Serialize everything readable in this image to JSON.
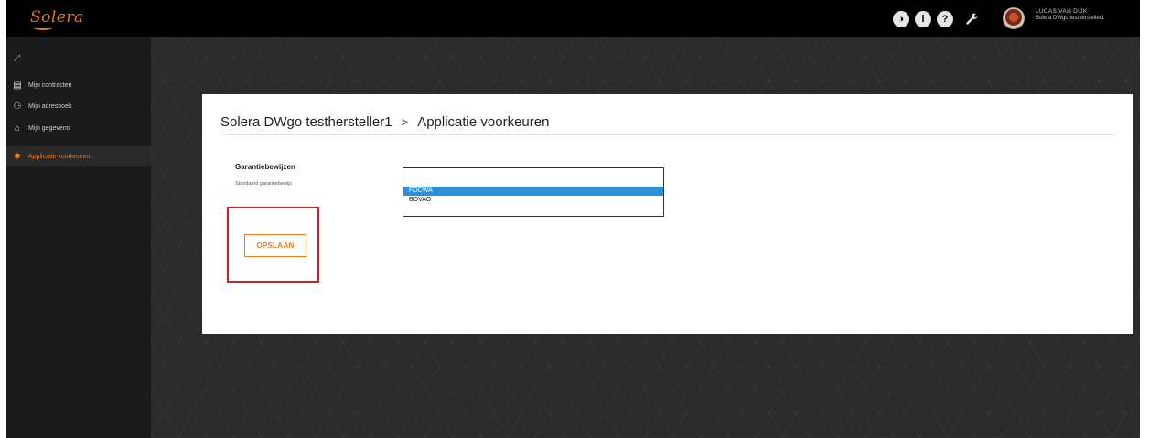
{
  "header": {
    "logo_text": "Solera",
    "icons": [
      "half-circle-icon",
      "info-icon",
      "help-icon",
      "wrench-icon"
    ],
    "icon_glyphs": [
      "◑",
      "i",
      "?",
      "🔧"
    ],
    "user_name": "LUCAS VAN DIJK",
    "user_company": "Solera DWgo testhersteller1"
  },
  "sidebar": {
    "collapse_glyph": "⤢",
    "items": [
      {
        "label": "Mijn contracten",
        "icon": "contract-icon",
        "glyph": "▤"
      },
      {
        "label": "Mijn adresboek",
        "icon": "add-contact-icon",
        "glyph": "⚇"
      },
      {
        "label": "Mijn gegevens",
        "icon": "home-icon",
        "glyph": "⌂"
      },
      {
        "label": "Applicatie voorkeuren",
        "icon": "gear-icon",
        "glyph": "✸",
        "active": true
      }
    ]
  },
  "card": {
    "breadcrumb": [
      "Solera DWgo testhersteller1",
      "Applicatie voorkeuren"
    ],
    "breadcrumb_separator": ">",
    "section_title": "Garantiebewijzen",
    "field_label": "Standaard garantiebewijs",
    "select": {
      "current": "",
      "options": [
        "FOCWA",
        "BOVAG"
      ],
      "selected_option": "FOCWA"
    },
    "save_label": "OPSLAAN"
  },
  "colors": {
    "accent": "#f07a1c",
    "selection": "#2f8fd6",
    "highlight_border": "#e0191e"
  }
}
